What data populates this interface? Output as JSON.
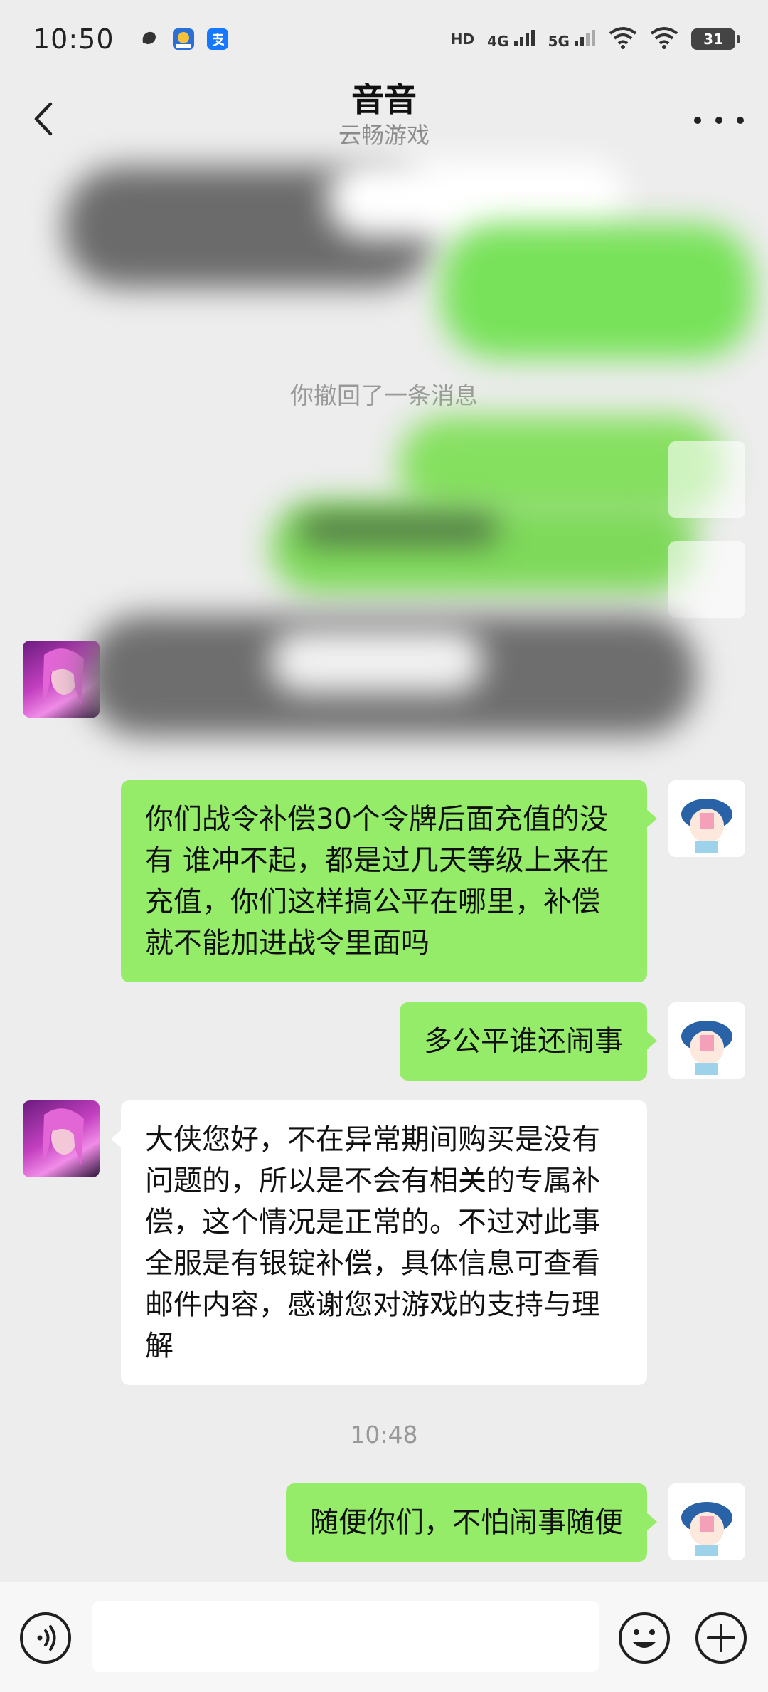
{
  "status_bar": {
    "time": "10:50",
    "signal_1": "HD",
    "signal_2": "4G",
    "signal_3": "5G",
    "battery": "31",
    "icons": [
      "app-icon",
      "app-icon-2",
      "alipay-icon",
      "wifi-icon",
      "wifi-icon-2"
    ]
  },
  "header": {
    "title": "音音",
    "subtitle": "云畅游戏"
  },
  "system_message": "你撤回了一条消息",
  "messages": [
    {
      "from": "me",
      "text": "你们战令补偿30个令牌后面充值的没有 谁冲不起，都是过几天等级上来在充值，你们这样搞公平在哪里，补偿就不能加进战令里面吗"
    },
    {
      "from": "me",
      "text": "多公平谁还闹事"
    },
    {
      "from": "other",
      "text": "大侠您好，不在异常期间购买是没有问题的，所以是不会有相关的专属补偿，这个情况是正常的。不过对此事全服是有银锭补偿，具体信息可查看邮件内容，感谢您对游戏的支持与理解"
    },
    {
      "from": "me",
      "text": "随便你们，不怕闹事随便"
    }
  ],
  "timestamp": "10:48",
  "input": {
    "value": "",
    "placeholder": ""
  },
  "colors": {
    "background": "#ededed",
    "my_bubble": "#95ec69",
    "other_bubble": "#ffffff"
  }
}
